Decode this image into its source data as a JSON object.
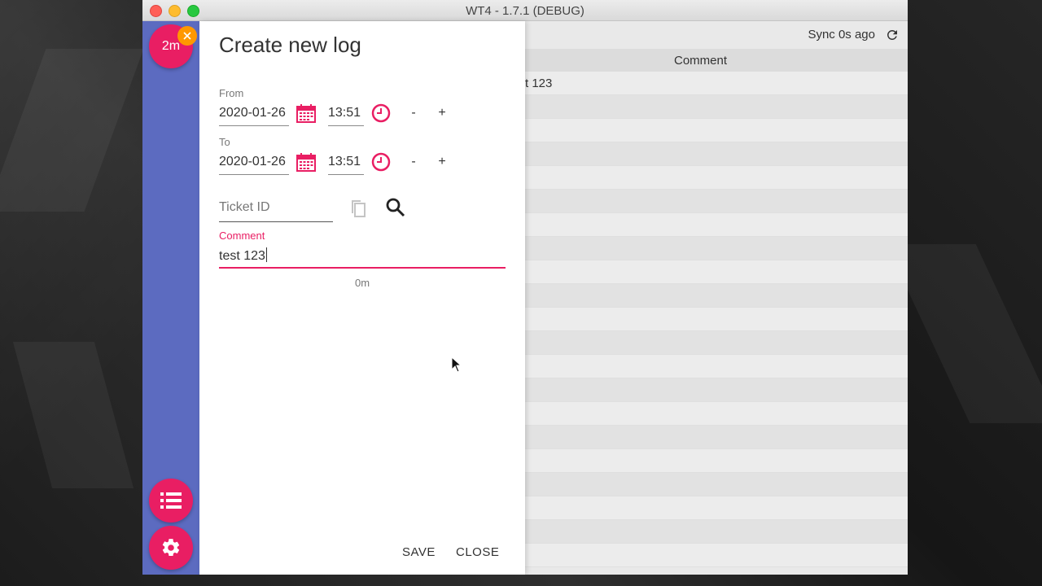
{
  "window": {
    "title": "WT4 - 1.7.1 (DEBUG)"
  },
  "background_app": {
    "sync_text": "Sync 0s ago",
    "refresh_icon": "refresh-icon",
    "table": {
      "column_header": "Comment",
      "rows": [
        "t 123",
        "",
        "",
        "",
        "",
        "",
        "",
        "",
        "",
        "",
        "",
        "",
        "",
        "",
        "",
        "",
        "",
        "",
        "",
        "",
        ""
      ]
    }
  },
  "sidebar": {
    "timer_label": "2m",
    "timer_badge_icon": "close-icon",
    "list_icon": "list-icon",
    "settings_icon": "gear-icon"
  },
  "dialog": {
    "title": "Create new log",
    "from": {
      "label": "From",
      "date": "2020-01-26",
      "time": "13:51",
      "minus": "-",
      "plus": "+"
    },
    "to": {
      "label": "To",
      "date": "2020-01-26",
      "time": "13:51",
      "minus": "-",
      "plus": "+"
    },
    "ticket": {
      "placeholder": "Ticket ID",
      "copy_icon": "copy-icon",
      "search_icon": "search-icon"
    },
    "comment": {
      "label": "Comment",
      "value": "test 123"
    },
    "duration": "0m",
    "save_label": "SAVE",
    "close_label": "CLOSE"
  },
  "colors": {
    "accent": "#e91e63",
    "sidebar": "#5c6bc0",
    "badge": "#ff9800"
  }
}
